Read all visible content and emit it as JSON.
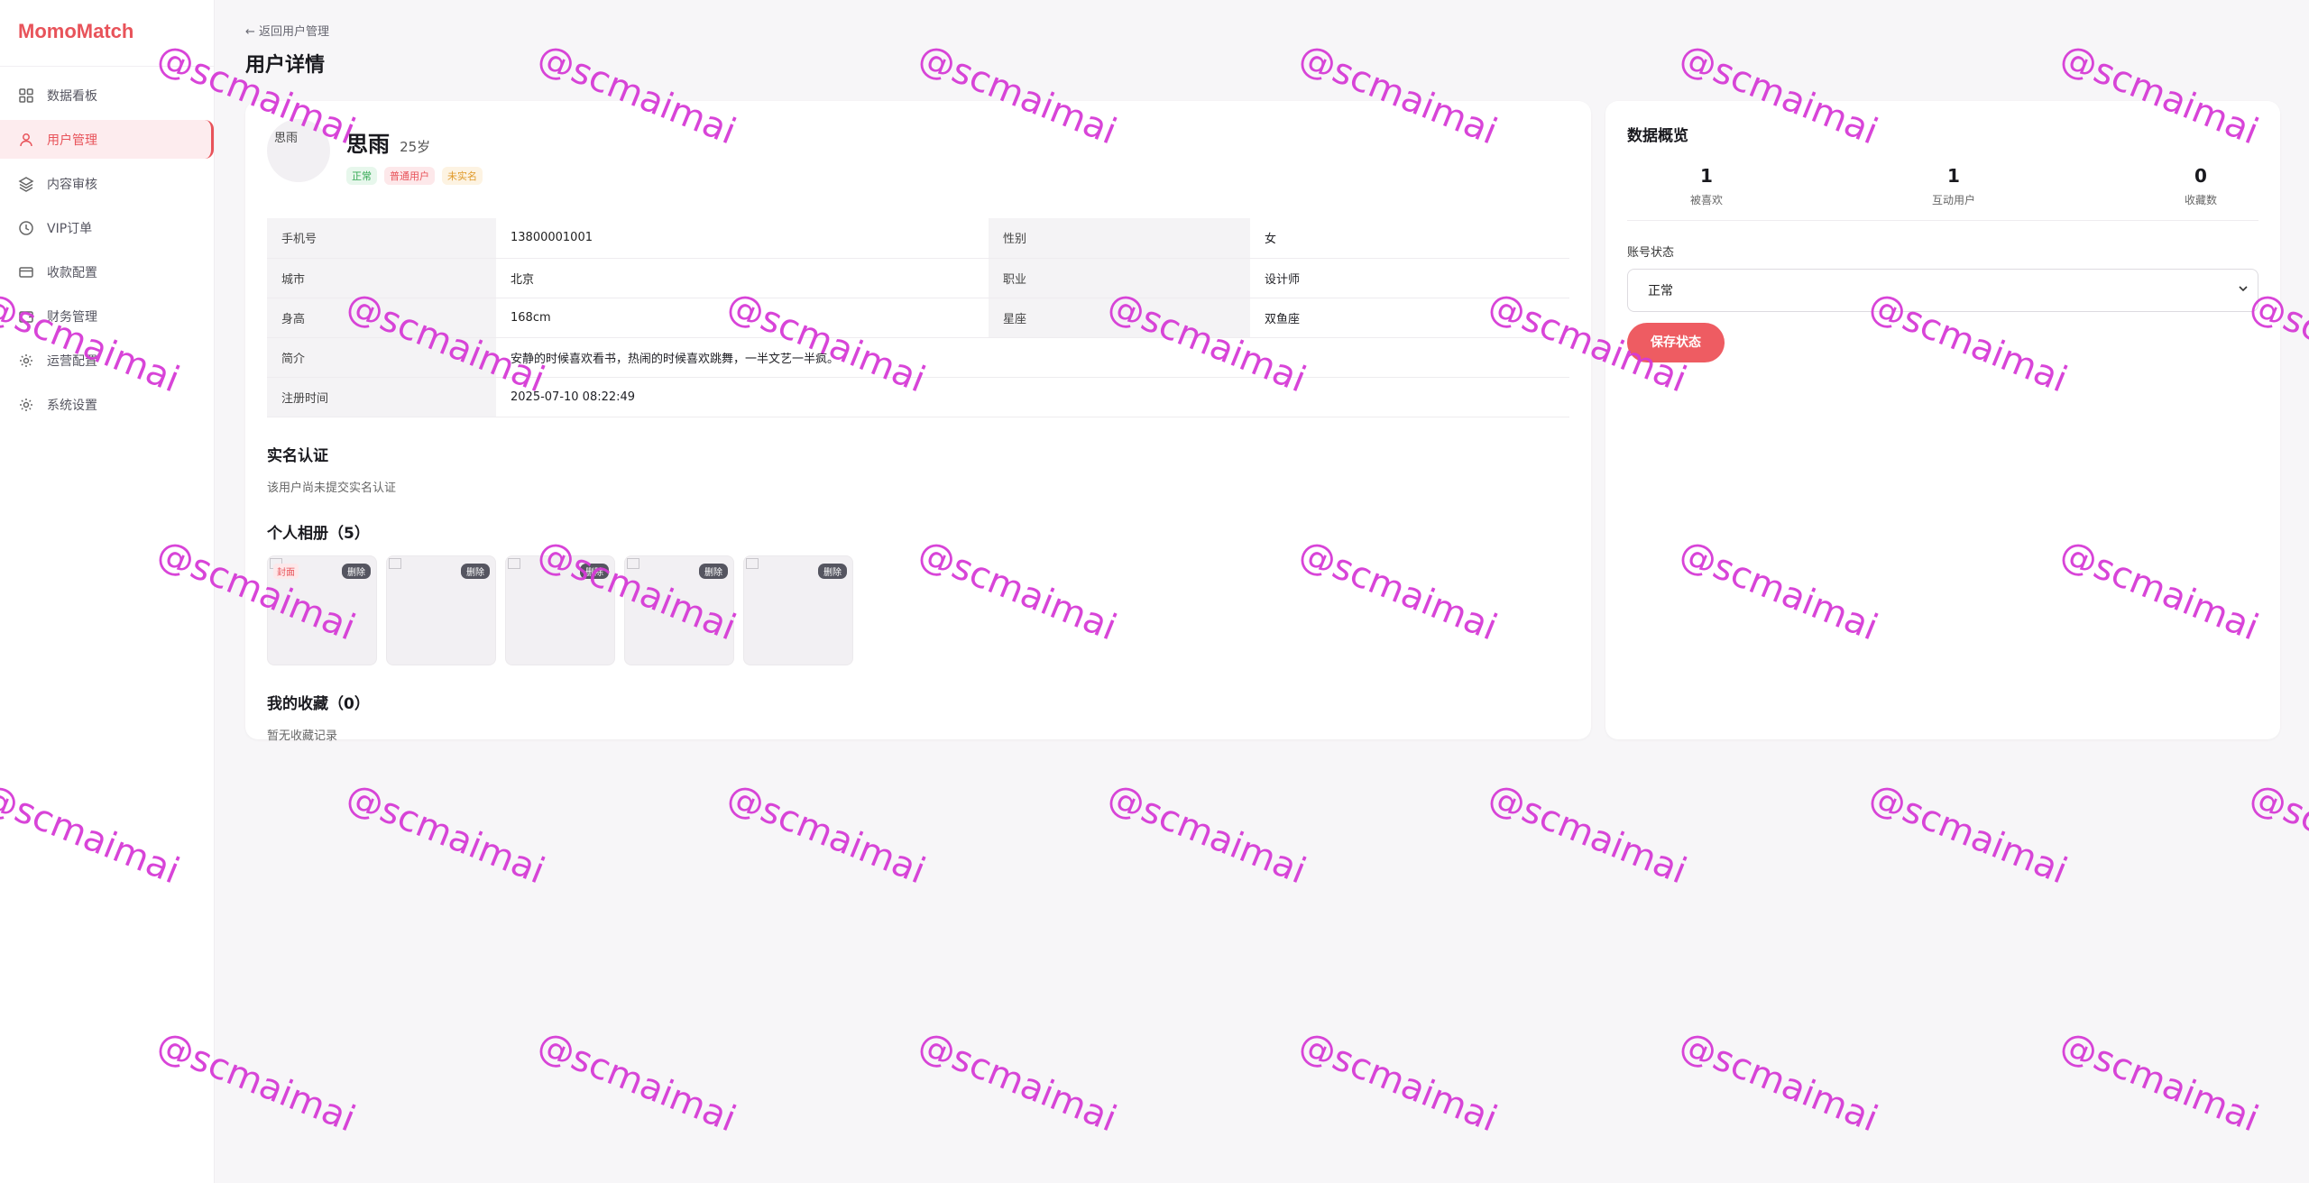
{
  "app": {
    "logo": "MomoMatch",
    "brand_color": "#e8535a"
  },
  "sidebar": {
    "items": [
      {
        "label": "数据看板",
        "icon": "grid-icon",
        "active": false
      },
      {
        "label": "用户管理",
        "icon": "user-icon",
        "active": true
      },
      {
        "label": "内容审核",
        "icon": "layers-icon",
        "active": false
      },
      {
        "label": "VIP订单",
        "icon": "clock-icon",
        "active": false
      },
      {
        "label": "收款配置",
        "icon": "card-icon",
        "active": false
      },
      {
        "label": "财务管理",
        "icon": "wallet-icon",
        "active": false
      },
      {
        "label": "运营配置",
        "icon": "gear-icon",
        "active": false
      },
      {
        "label": "系统设置",
        "icon": "gear-icon",
        "active": false
      }
    ]
  },
  "header": {
    "back": "← 返回用户管理",
    "title": "用户详情"
  },
  "profile": {
    "avatar_alt": "思雨",
    "name": "思雨",
    "age": "25岁",
    "tags": [
      "正常",
      "普通用户",
      "未实名"
    ]
  },
  "info": {
    "rows": [
      {
        "label": "手机号",
        "value": "13800001001",
        "label2": "性别",
        "value2": "女"
      },
      {
        "label": "城市",
        "value": "北京",
        "label2": "职业",
        "value2": "设计师"
      },
      {
        "label": "身高",
        "value": "168cm",
        "label2": "星座",
        "value2": "双鱼座"
      },
      {
        "label": "简介",
        "value": "安静的时候喜欢看书，热闹的时候喜欢跳舞，一半文艺一半疯。"
      },
      {
        "label": "注册时间",
        "value": "2025-07-10 08:22:49"
      }
    ]
  },
  "verification": {
    "title": "实名认证",
    "note": "该用户尚未提交实名认证"
  },
  "album": {
    "title": "个人相册（5）",
    "cover_label": "封面",
    "delete_label": "删除",
    "count": 5
  },
  "favorites": {
    "title": "我的收藏（0）",
    "note": "暂无收藏记录"
  },
  "overview": {
    "title": "数据概览",
    "stats": [
      {
        "value": "1",
        "label": "被喜欢"
      },
      {
        "value": "1",
        "label": "互动用户"
      },
      {
        "value": "0",
        "label": "收藏数"
      }
    ],
    "status_label": "账号状态",
    "status_value": "正常",
    "save_label": "保存状态"
  },
  "watermark": {
    "text": "@scmaimai"
  }
}
